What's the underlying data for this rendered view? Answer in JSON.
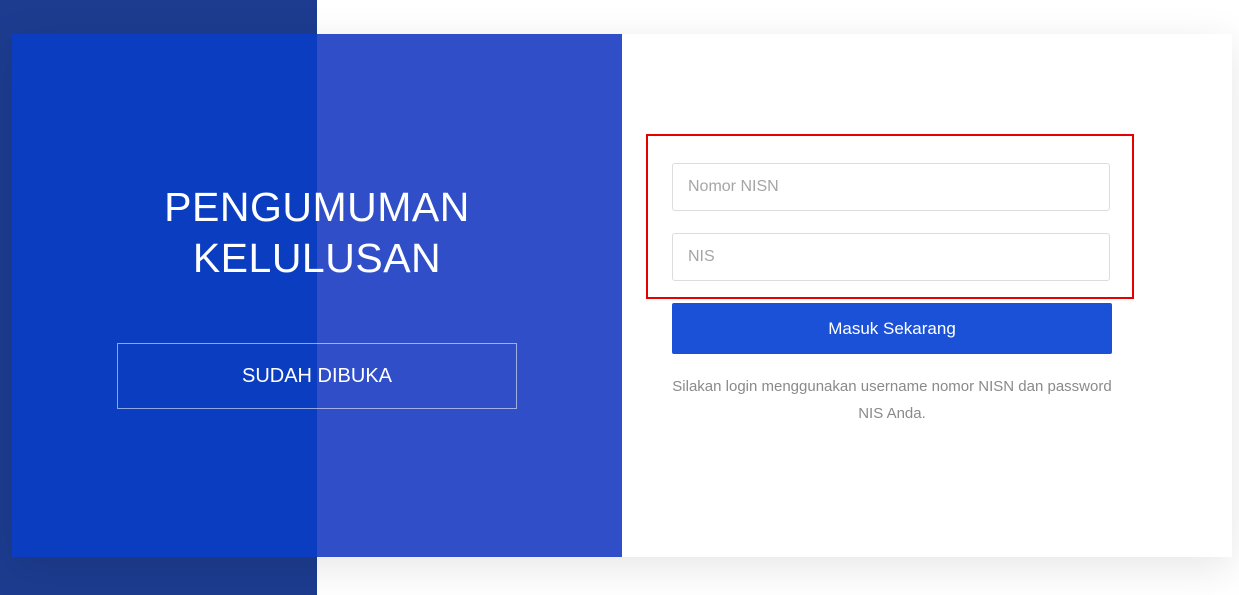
{
  "announcement": {
    "title_line1": "PENGUMUMAN",
    "title_line2": "KELULUSAN",
    "status": "SUDAH DIBUKA"
  },
  "login": {
    "nisn_placeholder": "Nomor NISN",
    "nis_placeholder": "NIS",
    "submit_label": "Masuk Sekarang",
    "hint": "Silakan login menggunakan username nomor NISN dan password NIS Anda."
  },
  "colors": {
    "primary": "#1b51d6",
    "panel": "#2f4ec8",
    "panel_dark": "#0a3dbf",
    "highlight": "#e60000"
  }
}
